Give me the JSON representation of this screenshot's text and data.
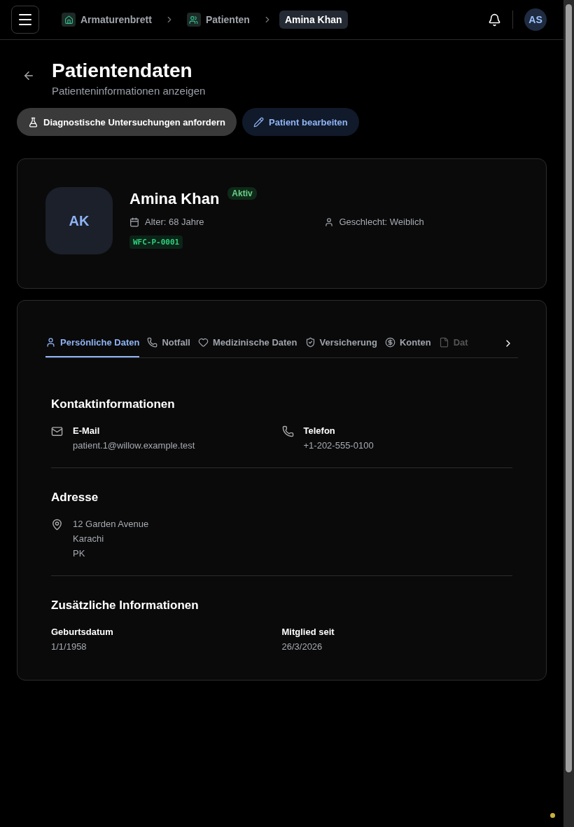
{
  "breadcrumbs": [
    {
      "label": "Armaturenbrett",
      "selected": false
    },
    {
      "label": "Patienten",
      "selected": false
    },
    {
      "label": "Amina Khan",
      "selected": true
    }
  ],
  "user": {
    "initials": "AS"
  },
  "page": {
    "title": "Patientendaten",
    "subtitle": "Patienteninformationen anzeigen"
  },
  "actions": [
    {
      "label": "Diagnostische Untersuchungen anfordern",
      "kind": "secondary"
    },
    {
      "label": "Patient bearbeiten",
      "kind": "primary"
    }
  ],
  "patient": {
    "initials": "AK",
    "name": "Amina Khan",
    "status": "Aktiv",
    "age": "Alter: 68 Jahre",
    "gender": "Geschlecht: Weiblich",
    "id": "WFC-P-0001"
  },
  "tabs": [
    {
      "label": "Persönliche Daten",
      "selected": true
    },
    {
      "label": "Notfall",
      "selected": false
    },
    {
      "label": "Medizinische Daten",
      "selected": false
    },
    {
      "label": "Versicherung",
      "selected": false
    },
    {
      "label": "Konten",
      "selected": false
    },
    {
      "label": "Dat",
      "selected": false
    }
  ],
  "sections": [
    {
      "title": "Kontaktinformationen",
      "kind": "contact",
      "fields": [
        {
          "label": "E-Mail",
          "value": "patient.1@willow.example.test"
        },
        {
          "label": "Telefon",
          "value": "+1-202-555-0100"
        }
      ]
    },
    {
      "title": "Adresse",
      "kind": "address",
      "lines": [
        "12 Garden Avenue",
        "Karachi",
        "PK"
      ]
    },
    {
      "title": "Zusätzliche Informationen",
      "kind": "grid",
      "fields": [
        {
          "label": "Geburtsdatum",
          "value": "1/1/1958"
        },
        {
          "label": "Mitglied seit",
          "value": "26/3/2026"
        }
      ]
    }
  ]
}
